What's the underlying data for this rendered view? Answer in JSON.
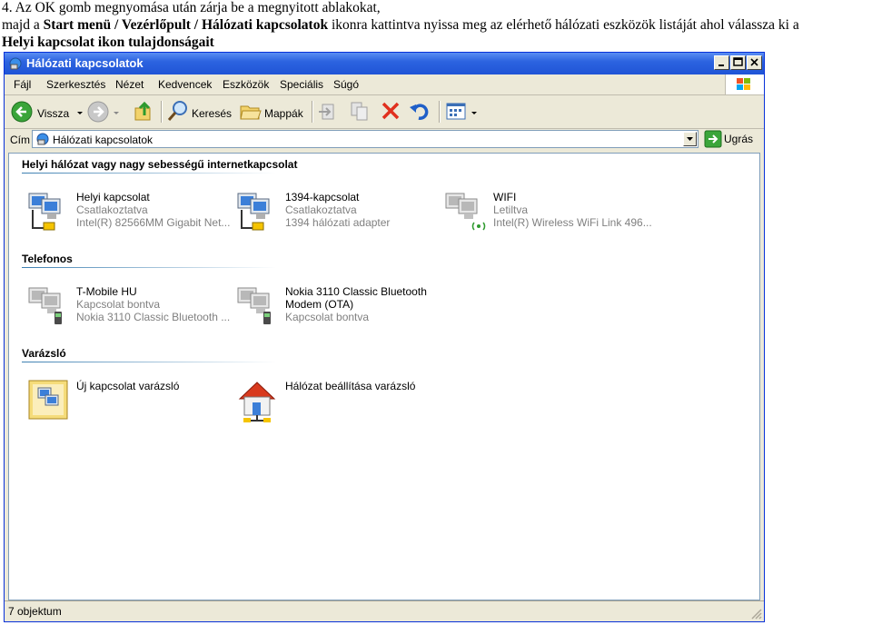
{
  "doc": {
    "line1": "4. Az OK gomb megnyomása után zárja be a megnyitott ablakokat,",
    "line2_pre": "majd a ",
    "line2_bold": "Start menü / Vezérlőpult / Hálózati kapcsolatok",
    "line2_post": " ikonra kattintva nyissa meg az elérhető hálózati eszközök listáját ahol válassza ki a",
    "line3_bold": "Helyi kapcsolat ikon tulajdonságait"
  },
  "window": {
    "title": "Hálózati kapcsolatok"
  },
  "menu": [
    {
      "u": "F",
      "rest": "ájl"
    },
    {
      "u": "S",
      "rest": "zerkesztés"
    },
    {
      "u": "N",
      "rest": "ézet"
    },
    {
      "u": "K",
      "rest": "edvencek",
      "pre": "Ke",
      "post": "dvencek"
    },
    {
      "u": "E",
      "rest": "szközök"
    },
    {
      "u": "p",
      "rest": "eciális",
      "pre": "S"
    },
    {
      "u": "S",
      "rest": "úgó"
    }
  ],
  "menu_labels": [
    "Fájl",
    "Szerkesztés",
    "Nézet",
    "Kedvencek",
    "Eszközök",
    "Speciális",
    "Súgó"
  ],
  "toolbar": {
    "back_label": "Vissza",
    "search_label": "Keresés",
    "folders_label": "Mappák"
  },
  "address": {
    "label": "Cím",
    "value": "Hálózati kapcsolatok",
    "go_label": "Ugrás"
  },
  "groups": {
    "lan": {
      "title": "Helyi hálózat vagy nagy sebességű internetkapcsolat",
      "items": [
        {
          "name": "Helyi kapcsolat",
          "status": "Csatlakoztatva",
          "device": "Intel(R) 82566MM Gigabit Net..."
        },
        {
          "name": "1394-kapcsolat",
          "status": "Csatlakoztatva",
          "device": "1394 hálózati adapter"
        },
        {
          "name": "WIFI",
          "status": "Letiltva",
          "device": "Intel(R) Wireless WiFi Link 496..."
        }
      ]
    },
    "dialup": {
      "title": "Telefonos",
      "items": [
        {
          "name": "T-Mobile HU",
          "status": "Kapcsolat bontva",
          "device": "Nokia 3110 Classic Bluetooth ..."
        },
        {
          "name": "Nokia 3110 Classic Bluetooth",
          "name2": "Modem (OTA)",
          "status": "Kapcsolat bontva"
        }
      ]
    },
    "wizard": {
      "title": "Varázsló",
      "items": [
        {
          "name": "Új kapcsolat varázsló"
        },
        {
          "name": "Hálózat beállítása varázsló"
        }
      ]
    }
  },
  "status": {
    "text": "7 objektum"
  },
  "colors": {
    "titlebar": "#2c63e0",
    "window_bg": "#ece9d8",
    "group_line": "#3c7fb1",
    "sub_text": "#808080"
  }
}
